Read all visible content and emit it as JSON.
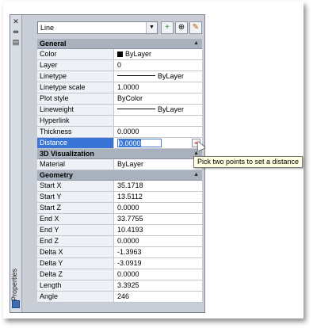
{
  "palette": {
    "title": "Properties",
    "strip_icons": [
      "close-x-icon",
      "auto-hide-icon",
      "properties-menu-icon"
    ],
    "object_type": "Line",
    "toolbar": [
      {
        "name": "toggle-pickadd-icon",
        "glyph": "+"
      },
      {
        "name": "select-objects-icon",
        "glyph": "⊕"
      },
      {
        "name": "quick-select-icon",
        "glyph": "✎"
      }
    ]
  },
  "sections": {
    "general": {
      "label": "General",
      "rows": [
        {
          "key": "Color",
          "value": "ByLayer",
          "swatch": "#000000"
        },
        {
          "key": "Layer",
          "value": "0"
        },
        {
          "key": "Linetype",
          "value": "ByLayer",
          "line": true
        },
        {
          "key": "Linetype scale",
          "value": "1.0000"
        },
        {
          "key": "Plot style",
          "value": "ByColor"
        },
        {
          "key": "Lineweight",
          "value": "ByLayer",
          "line": true
        },
        {
          "key": "Hyperlink",
          "value": ""
        },
        {
          "key": "Thickness",
          "value": "0.0000"
        },
        {
          "key": "Distance",
          "value": "0.0000",
          "selected": true
        }
      ]
    },
    "visualization": {
      "label": "3D Visualization",
      "rows": [
        {
          "key": "Material",
          "value": "ByLayer"
        }
      ]
    },
    "geometry": {
      "label": "Geometry",
      "rows": [
        {
          "key": "Start X",
          "value": "35.1718"
        },
        {
          "key": "Start Y",
          "value": "13.5112"
        },
        {
          "key": "Start Z",
          "value": "0.0000"
        },
        {
          "key": "End X",
          "value": "33.7755"
        },
        {
          "key": "End Y",
          "value": "10.4193"
        },
        {
          "key": "End Z",
          "value": "0.0000"
        },
        {
          "key": "Delta X",
          "value": "-1.3963"
        },
        {
          "key": "Delta Y",
          "value": "-3.0919"
        },
        {
          "key": "Delta Z",
          "value": "0.0000"
        },
        {
          "key": "Length",
          "value": "3.3925"
        },
        {
          "key": "Angle",
          "value": "246"
        }
      ]
    }
  },
  "tooltip": "Pick two points to set a distance",
  "colors": {
    "selection": "#3875d6",
    "section_header": "#a9b1bd",
    "tooltip_bg": "#ffffe1"
  }
}
